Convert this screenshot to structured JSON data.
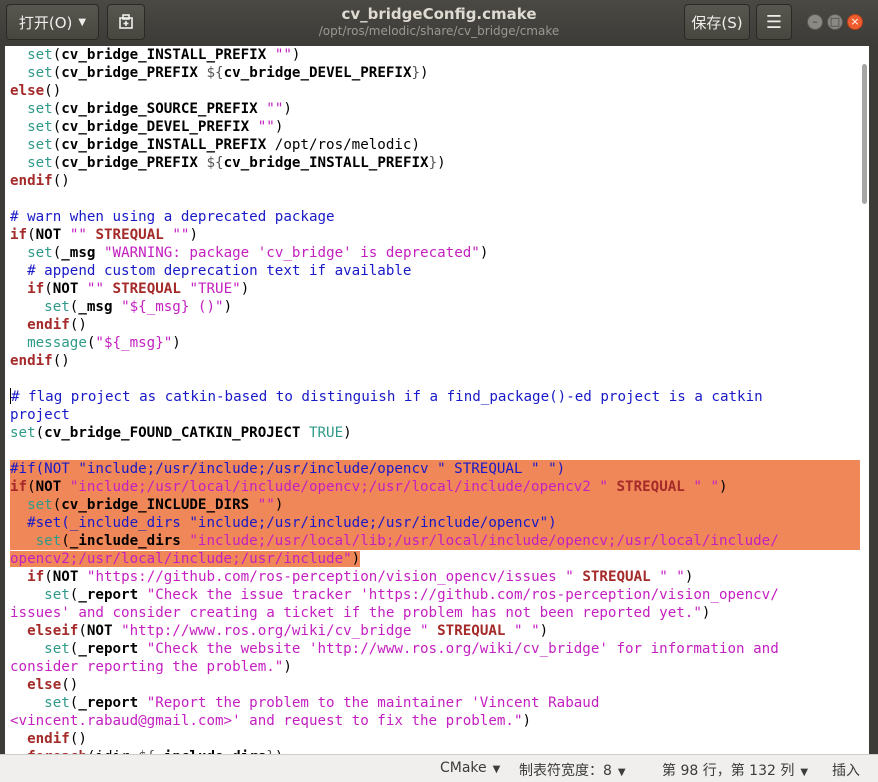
{
  "header": {
    "open_label": "打开(O)",
    "save_label": "保存(S)",
    "title": "cv_bridgeConfig.cmake",
    "path": "/opt/ros/melodic/share/cv_bridge/cmake"
  },
  "status": {
    "language": "CMake",
    "tab_width": "制表符宽度：8",
    "position": "第 98 行，第 132 列",
    "mode": "插入"
  },
  "code": {
    "l01": "  set(cv_bridge_INSTALL_PREFIX \"\")",
    "l02": "  set(cv_bridge_PREFIX ${cv_bridge_DEVEL_PREFIX})",
    "l03": "else()",
    "l04": "  set(cv_bridge_SOURCE_PREFIX \"\")",
    "l05": "  set(cv_bridge_DEVEL_PREFIX \"\")",
    "l06": "  set(cv_bridge_INSTALL_PREFIX /opt/ros/melodic)",
    "l07": "  set(cv_bridge_PREFIX ${cv_bridge_INSTALL_PREFIX})",
    "l08": "endif()",
    "l10": "# warn when using a deprecated package",
    "l11": "if(NOT \"\" STREQUAL \"\")",
    "l12": "  set(_msg \"WARNING: package 'cv_bridge' is deprecated\")",
    "l13": "  # append custom deprecation text if available",
    "l14": "  if(NOT \"\" STREQUAL \"TRUE\")",
    "l15": "    set(_msg \"${_msg} ()\")",
    "l16": "  endif()",
    "l17": "  message(\"${_msg}\")",
    "l18": "endif()",
    "l20": "# flag project as catkin-based to distinguish if a find_package()-ed project is a catkin",
    "l21": "project",
    "l22": "set(cv_bridge_FOUND_CATKIN_PROJECT TRUE)",
    "l24": "#if(NOT \"include;/usr/include;/usr/include/opencv \" STREQUAL \" \")",
    "l25": "if(NOT \"include;/usr/local/include/opencv;/usr/local/include/opencv2 \" STREQUAL \" \")",
    "l26": "  set(cv_bridge_INCLUDE_DIRS \"\")",
    "l27": "  #set(_include_dirs \"include;/usr/include;/usr/include/opencv\")",
    "l28": "   set(_include_dirs \"include;/usr/local/lib;/usr/local/include/opencv;/usr/local/include/",
    "l29": "opencv2;/usr/local/include;/usr/include\")",
    "l30": "  if(NOT \"https://github.com/ros-perception/vision_opencv/issues \" STREQUAL \" \")",
    "l31": "    set(_report \"Check the issue tracker 'https://github.com/ros-perception/vision_opencv/",
    "l32": "issues' and consider creating a ticket if the problem has not been reported yet.\")",
    "l33": "  elseif(NOT \"http://www.ros.org/wiki/cv_bridge \" STREQUAL \" \")",
    "l34": "    set(_report \"Check the website 'http://www.ros.org/wiki/cv_bridge' for information and",
    "l35": "consider reporting the problem.\")",
    "l36": "  else()",
    "l37": "    set(_report \"Report the problem to the maintainer 'Vincent Rabaud",
    "l38": "<vincent.rabaud@gmail.com>' and request to fix the problem.\")",
    "l39": "  endif()",
    "l40": "  foreach(idir ${_include_dirs})"
  }
}
